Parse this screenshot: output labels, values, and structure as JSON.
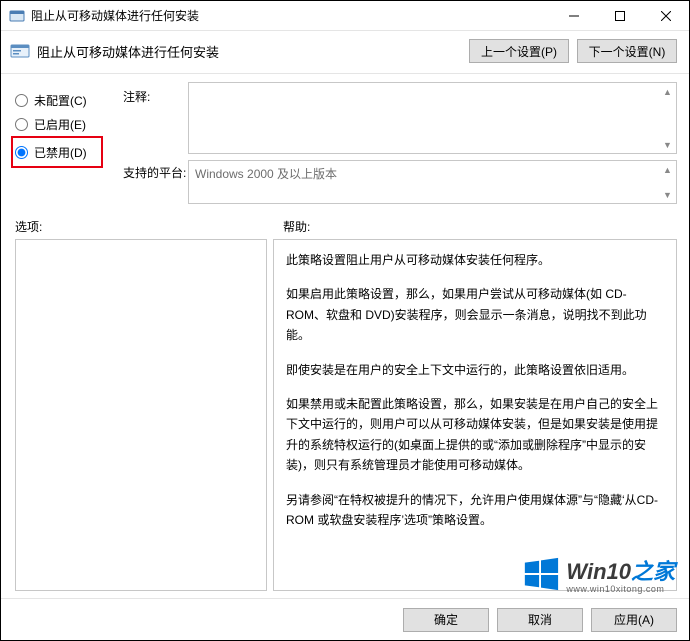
{
  "window": {
    "title": "阻止从可移动媒体进行任何安装"
  },
  "header": {
    "title": "阻止从可移动媒体进行任何安装",
    "prev": "上一个设置(P)",
    "next": "下一个设置(N)"
  },
  "radios": {
    "not_configured": "未配置(C)",
    "enabled": "已启用(E)",
    "disabled": "已禁用(D)"
  },
  "labels": {
    "comment": "注释:",
    "platform": "支持的平台:",
    "options": "选项:",
    "help": "帮助:"
  },
  "fields": {
    "comment": "",
    "platform": "Windows 2000 及以上版本"
  },
  "help": {
    "p1": "此策略设置阻止用户从可移动媒体安装任何程序。",
    "p2": "如果启用此策略设置，那么，如果用户尝试从可移动媒体(如 CD-ROM、软盘和 DVD)安装程序，则会显示一条消息，说明找不到此功能。",
    "p3": "即使安装是在用户的安全上下文中运行的，此策略设置依旧适用。",
    "p4": "如果禁用或未配置此策略设置，那么，如果安装是在用户自己的安全上下文中运行的，则用户可以从可移动媒体安装，但是如果安装是使用提升的系统特权运行的(如桌面上提供的或“添加或删除程序”中显示的安装)，则只有系统管理员才能使用可移动媒体。",
    "p5": "另请参阅“在特权被提升的情况下，允许用户使用媒体源”与“隐藏‘从CD-ROM 或软盘安装程序’选项”策略设置。"
  },
  "footer": {
    "ok": "确定",
    "cancel": "取消",
    "apply": "应用(A)"
  },
  "watermark": {
    "brand": "Win10",
    "suffix": "之家",
    "url": "www.win10xitong.com"
  }
}
